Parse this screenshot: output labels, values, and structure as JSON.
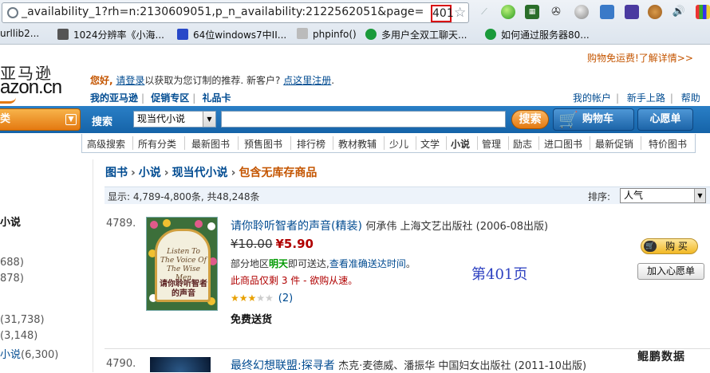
{
  "browser": {
    "url_text": "_availability_1?rh=n:2130609051,p_n_availability:2122562051&page=",
    "url_page": "401",
    "bookmarks": [
      "urllib2...",
      "1024分辨率《小海...",
      "64位windows7中II...",
      "phpinfo()",
      "多用户全双工聊天...",
      "如何通过服务器80..."
    ]
  },
  "header": {
    "logo_cn": "亚马逊",
    "logo_en_bold": "azon",
    "logo_en_suffix": ".cn",
    "free_shipping": "购物免运费!了解详情>>",
    "greeting_hi": "您好,",
    "greeting_login": "请登录",
    "greeting_mid": "以获取为您订制的推荐. 新客户?",
    "greeting_register": "点这里注册",
    "greeting_end": ".",
    "toplinks": [
      "我的亚马逊",
      "促销专区",
      "礼品卡"
    ],
    "rightlinks": [
      "我的帐户",
      "新手上路",
      "帮助"
    ]
  },
  "search": {
    "category_button": "类",
    "label": "搜索",
    "selected_category": "现当代小说",
    "query": "",
    "search_button": "搜索",
    "cart_button": "购物车",
    "wishlist_button": "心愿单"
  },
  "nav": [
    "高级搜索",
    "所有分类",
    "最新图书",
    "预售图书",
    "排行榜",
    "教材教辅",
    "少儿",
    "文学",
    "小说",
    "管理",
    "励志",
    "进口图书",
    "最新促销",
    "特价图书"
  ],
  "sidebar": {
    "heading": "小说",
    "items": [
      {
        "label": "",
        "count": "688)"
      },
      {
        "label": "",
        "count": "878)"
      },
      {
        "label": "",
        "count": "(31,738)"
      },
      {
        "label": "",
        "count": "(3,148)"
      },
      {
        "label": "小说",
        "count": "(6,300)"
      }
    ]
  },
  "breadcrumb": {
    "items": [
      "图书",
      "小说",
      "现当代小说"
    ],
    "current": "包含无库存商品",
    "separator": "›"
  },
  "results": {
    "count_text": "显示: 4,789-4,800条, 共48,248条",
    "sort_label": "排序:",
    "sort_value": "人气"
  },
  "item1": {
    "index": "4789.",
    "title": "请你聆听智者的声音(精装)",
    "meta": "何承伟 上海文艺出版社 (2006-08出版)",
    "price_old": "¥10.00",
    "price_new": "¥5.90",
    "avail_pre": "部分地区",
    "avail_tomorrow": "明天",
    "avail_mid": "即可送达,",
    "avail_link": "查看准确送达时间",
    "avail_end": "。",
    "stock": "此商品仅剩 3 件 - 欲购从速。",
    "rating": 3.5,
    "review_count": "(2)",
    "shipping": "免费送货",
    "buy_button": "购 买",
    "wishlist_button": "加入心愿单",
    "cover_en": "Listen To The Voice Of The Wise Men",
    "cover_zh": "请你聆听智者的声音"
  },
  "annotation": "第401页",
  "item2": {
    "index": "4790.",
    "title": "最终幻想联盟:探寻者",
    "meta": "杰克·麦德威、潘振华 中国妇女出版社 (2011-10出版)"
  },
  "watermark": "鲲鹏数据"
}
